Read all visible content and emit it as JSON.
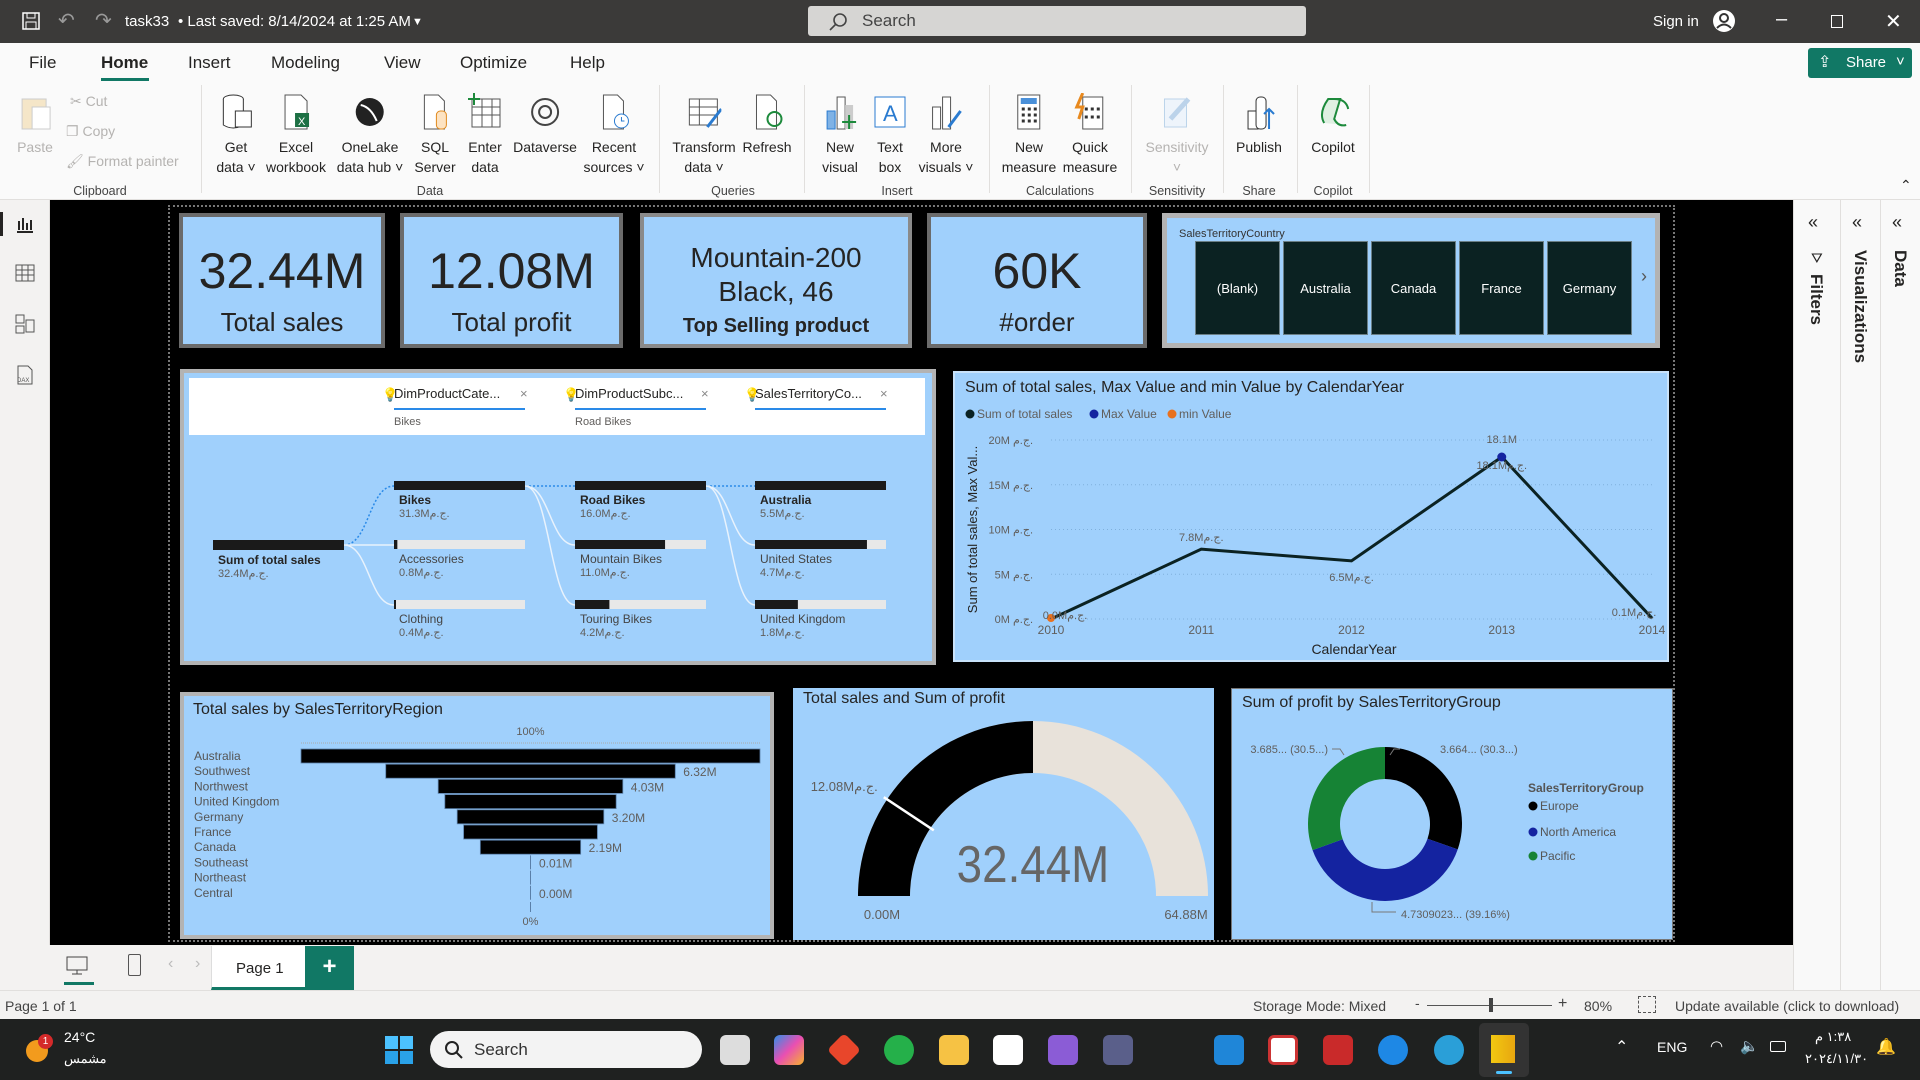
{
  "titlebar": {
    "file_name": "task33",
    "saved": "• Last saved: 8/14/2024 at 1:25 AM",
    "search": "Search",
    "sign_in": "Sign in"
  },
  "menu": {
    "tabs": [
      "File",
      "Home",
      "Insert",
      "Modeling",
      "View",
      "Optimize",
      "Help"
    ],
    "active": "Home",
    "share": "Share"
  },
  "ribbon": {
    "clipboard": {
      "paste": "Paste",
      "cut": "Cut",
      "copy": "Copy",
      "format_painter": "Format painter",
      "group": "Clipboard"
    },
    "data": {
      "get_data": [
        "Get",
        "data ˅"
      ],
      "excel": [
        "Excel",
        "workbook"
      ],
      "onelake": [
        "OneLake",
        "data hub ˅"
      ],
      "sql": [
        "SQL",
        "Server"
      ],
      "enter": [
        "Enter",
        "data"
      ],
      "dataverse": [
        "Dataverse",
        ""
      ],
      "recent": [
        "Recent",
        "sources ˅"
      ],
      "group": "Data"
    },
    "queries": {
      "transform": [
        "Transform",
        "data ˅"
      ],
      "refresh": [
        "Refresh",
        ""
      ],
      "group": "Queries"
    },
    "insert": {
      "new_visual": [
        "New",
        "visual"
      ],
      "text_box": [
        "Text",
        "box"
      ],
      "more_visuals": [
        "More",
        "visuals ˅"
      ],
      "group": "Insert"
    },
    "calculations": {
      "new_measure": [
        "New",
        "measure"
      ],
      "quick_measure": [
        "Quick",
        "measure"
      ],
      "group": "Calculations"
    },
    "sensitivity": {
      "sensitivity": [
        "Sensitivity",
        "˅"
      ],
      "group": "Sensitivity"
    },
    "share": {
      "publish": [
        "Publish",
        ""
      ],
      "group": "Share"
    },
    "copilot": {
      "copilot": [
        "Copilot",
        ""
      ],
      "group": "Copilot"
    }
  },
  "cards": [
    {
      "value": "32.44M",
      "label": "Total sales"
    },
    {
      "value": "12.08M",
      "label": "Total profit"
    },
    {
      "value_line1": "Mountain-200",
      "value_line2": "Black, 46",
      "label": "Top Selling product"
    },
    {
      "value": "60K",
      "label": "#order"
    }
  ],
  "slicer": {
    "title": "SalesTerritoryCountry",
    "items": [
      "(Blank)",
      "Australia",
      "Canada",
      "France",
      "Germany"
    ]
  },
  "decomp": {
    "filters": [
      {
        "label": "DimProductCate...",
        "value": "Bikes"
      },
      {
        "label": "DimProductSubc...",
        "value": "Road Bikes"
      },
      {
        "label": "SalesTerritoryCo...",
        "value": ""
      }
    ],
    "root": {
      "name": "Sum of total sales",
      "value": "32.4Mج.م."
    },
    "columns": [
      [
        {
          "name": "Bikes",
          "value": "31.3Mج.م.",
          "num": 31.3,
          "selected": true
        },
        {
          "name": "Accessories",
          "value": "0.8Mج.م.",
          "num": 0.8
        },
        {
          "name": "Clothing",
          "value": "0.4Mج.م.",
          "num": 0.4
        }
      ],
      [
        {
          "name": "Road Bikes",
          "value": "16.0Mج.م.",
          "num": 16.0,
          "selected": true
        },
        {
          "name": "Mountain Bikes",
          "value": "11.0Mج.م.",
          "num": 11.0
        },
        {
          "name": "Touring Bikes",
          "value": "4.2Mج.م.",
          "num": 4.2
        }
      ],
      [
        {
          "name": "Australia",
          "value": "5.5Mج.م.",
          "num": 5.5,
          "selected": true
        },
        {
          "name": "United States",
          "value": "4.7Mج.م.",
          "num": 4.7
        },
        {
          "name": "United Kingdom",
          "value": "1.8Mج.م.",
          "num": 1.8
        }
      ]
    ]
  },
  "chart_data": [
    {
      "type": "line",
      "title": "Sum of total sales, Max Value and min Value by CalendarYear",
      "legend": [
        {
          "name": "Sum of total sales",
          "color": "#0b2222"
        },
        {
          "name": "Max Value",
          "color": "#1423a0"
        },
        {
          "name": "min Value",
          "color": "#e8711f"
        }
      ],
      "x": [
        2010,
        2011,
        2012,
        2013,
        2014
      ],
      "values": [
        0.0,
        7.8,
        6.5,
        18.1,
        0.1
      ],
      "data_labels": [
        "0.0Mج.م.",
        "7.8Mج.م.",
        "6.5Mج.م.",
        "18.1Mج.م.",
        "0.1Mج.م."
      ],
      "max_label": "18.1M",
      "max_index": 3,
      "min_index": 0,
      "yticks": [
        "0M ج.م.",
        "5M ج.م.",
        "10M ج.م.",
        "15M ج.م.",
        "20M ج.م."
      ],
      "ylim": [
        0,
        20
      ],
      "xlabel": "CalendarYear",
      "ylabel": "Sum of total sales, Max Val..."
    },
    {
      "type": "funnel",
      "title": "Total sales by SalesTerritoryRegion",
      "categories": [
        "Australia",
        "Southwest",
        "Northwest",
        "United Kingdom",
        "Germany",
        "France",
        "Canada",
        "Southeast",
        "Northeast",
        "Central"
      ],
      "values": [
        10.02,
        6.32,
        4.03,
        3.74,
        3.2,
        2.92,
        2.19,
        0.01,
        0.01,
        0.0
      ],
      "labels": [
        "",
        "6.32M",
        "4.03M",
        "",
        "3.20M",
        "",
        "2.19M",
        "0.01M",
        "",
        "0.00M"
      ],
      "top_label": "100%",
      "bottom_label": "0%"
    },
    {
      "type": "gauge",
      "title": "Total sales and Sum of profit",
      "value": 32.44,
      "value_label": "32.44M",
      "min": 0,
      "max": 64.88,
      "min_label": "0.00M",
      "max_label": "64.88M",
      "target": 12.08,
      "target_label": "12.08Mج.م."
    },
    {
      "type": "pie",
      "title": "Sum of profit by SalesTerritoryGroup",
      "legend_title": "SalesTerritoryGroup",
      "categories": [
        "Europe",
        "North America",
        "Pacific"
      ],
      "values": [
        3.664,
        4.7309,
        3.685
      ],
      "colors": [
        "#000000",
        "#1423a0",
        "#168335"
      ],
      "data_labels": [
        "3.664... (30.3...)",
        "4.7309023... (39.16%)",
        "3.685... (30.5...)"
      ]
    }
  ],
  "panes": {
    "filters": "Filters",
    "visualizations": "Visualizations",
    "data": "Data"
  },
  "page_tabs": {
    "page": "Page 1",
    "add": "+"
  },
  "status": {
    "page": "Page 1 of 1",
    "storage": "Storage Mode: Mixed",
    "zoom": "80%",
    "zoom_value": 80,
    "update": "Update available (click to download)"
  },
  "taskbar": {
    "temp": "24°C",
    "weather": "مشمس",
    "badge": "1",
    "search": "Search",
    "lang": "ENG",
    "time": "١:٣٨ م",
    "date": "٢٠٢٤/١١/٣٠"
  }
}
